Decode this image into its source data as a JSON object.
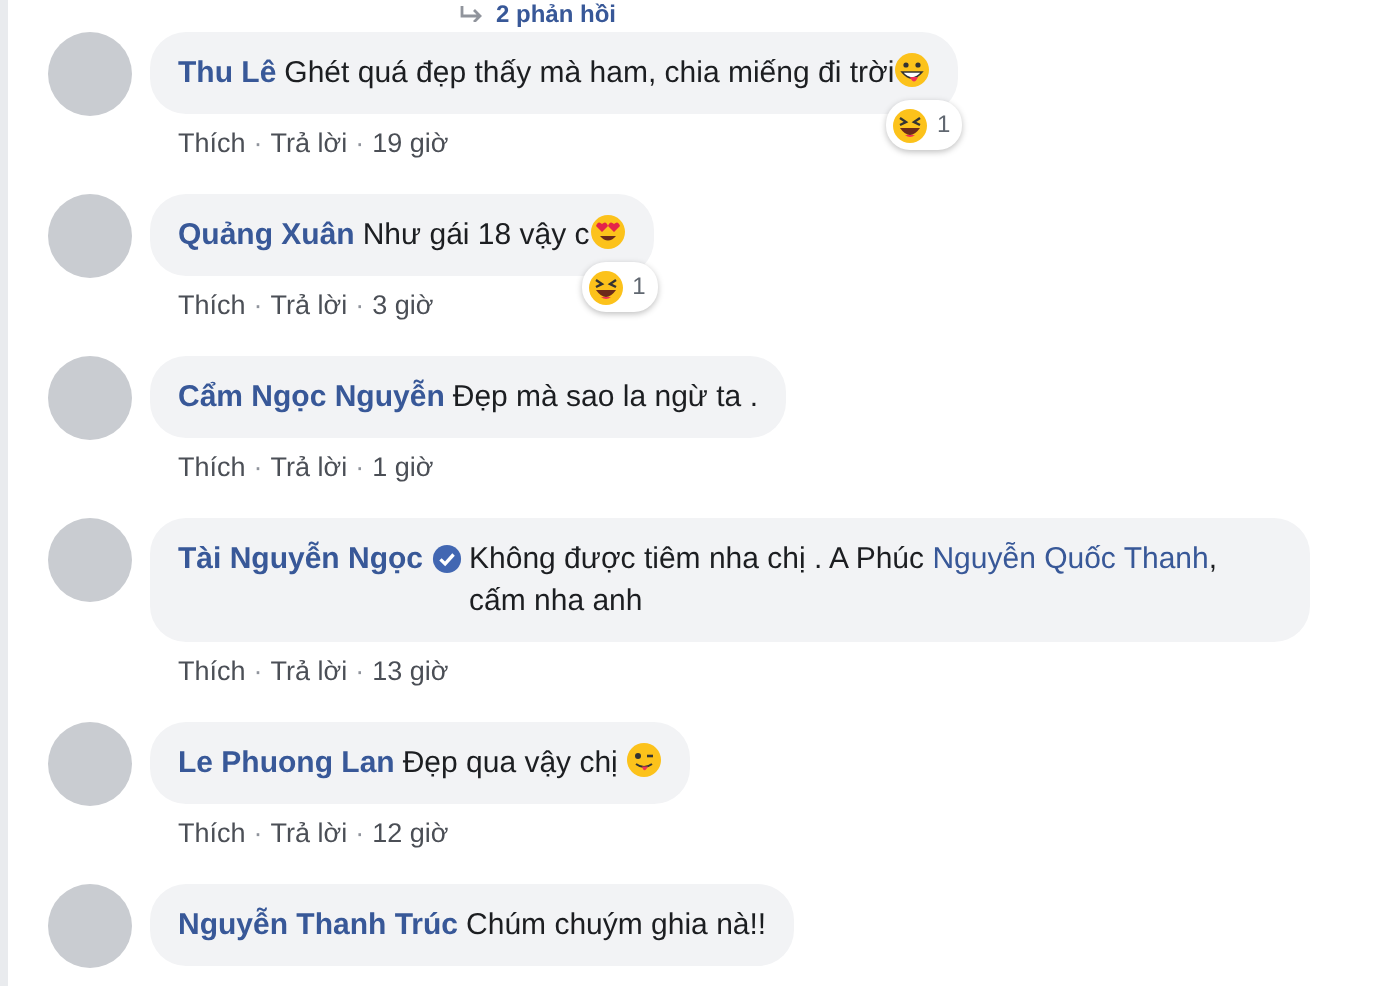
{
  "replies_link": {
    "label": "2 phản hồi"
  },
  "comments": [
    {
      "author": "Thu Lê",
      "verified": false,
      "segments": [
        {
          "kind": "text",
          "text": "Ghét quá đẹp thấy mà ham, chia miếng đi trời"
        },
        {
          "kind": "grin"
        }
      ],
      "reaction": {
        "kind": "laugh",
        "count": "1"
      },
      "actions": [
        {
          "kind": "like",
          "text": "Thích"
        },
        {
          "kind": "dot",
          "text": "·"
        },
        {
          "kind": "reply",
          "text": "Trả lời"
        },
        {
          "kind": "dot",
          "text": "·"
        },
        {
          "kind": "time",
          "text": "19 giờ"
        }
      ]
    },
    {
      "author": "Quảng Xuân",
      "verified": false,
      "segments": [
        {
          "kind": "text",
          "text": "Như gái 18 vậy c"
        },
        {
          "kind": "heart-eyes"
        }
      ],
      "reaction": {
        "kind": "laugh",
        "count": "1"
      },
      "actions": [
        {
          "kind": "like",
          "text": "Thích"
        },
        {
          "kind": "dot",
          "text": "·"
        },
        {
          "kind": "reply",
          "text": "Trả lời"
        },
        {
          "kind": "dot",
          "text": "·"
        },
        {
          "kind": "time",
          "text": "3 giờ"
        }
      ]
    },
    {
      "author": "Cẩm Ngọc Nguyễn",
      "verified": false,
      "segments": [
        {
          "kind": "text",
          "text": "Đẹp mà sao la ngừ ta ."
        }
      ],
      "actions": [
        {
          "kind": "like",
          "text": "Thích"
        },
        {
          "kind": "dot",
          "text": "·"
        },
        {
          "kind": "reply",
          "text": "Trả lời"
        },
        {
          "kind": "dot",
          "text": "·"
        },
        {
          "kind": "time",
          "text": "1 giờ"
        }
      ]
    },
    {
      "author": "Tài Nguyễn Ngọc",
      "verified": true,
      "segments": [
        {
          "kind": "text",
          "text": "Không được tiêm nha chị . A Phúc "
        },
        {
          "kind": "mention",
          "text": "Nguyễn Quốc Thanh"
        },
        {
          "kind": "text",
          "text": ", cấm nha anh"
        }
      ],
      "actions": [
        {
          "kind": "like",
          "text": "Thích"
        },
        {
          "kind": "dot",
          "text": "·"
        },
        {
          "kind": "reply",
          "text": "Trả lời"
        },
        {
          "kind": "dot",
          "text": "·"
        },
        {
          "kind": "time",
          "text": "13 giờ"
        }
      ]
    },
    {
      "author": "Le Phuong Lan",
      "verified": false,
      "segments": [
        {
          "kind": "text",
          "text": "Đẹp qua vậy chị "
        },
        {
          "kind": "wink-tongue"
        }
      ],
      "actions": [
        {
          "kind": "like",
          "text": "Thích"
        },
        {
          "kind": "dot",
          "text": "·"
        },
        {
          "kind": "reply",
          "text": "Trả lời"
        },
        {
          "kind": "dot",
          "text": "·"
        },
        {
          "kind": "time",
          "text": "12 giờ"
        }
      ]
    },
    {
      "author": "Nguyễn Thanh Trúc",
      "verified": false,
      "segments": [
        {
          "kind": "text",
          "text": "Chúm chuým ghia nà!!"
        }
      ]
    }
  ]
}
